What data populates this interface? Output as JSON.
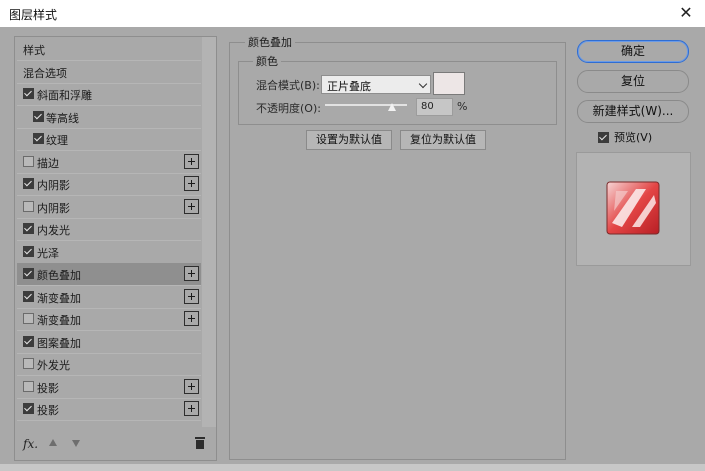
{
  "window": {
    "title": "图层样式",
    "close_glyph": "✕"
  },
  "styles_list": {
    "items": [
      {
        "label": "样式",
        "checkbox": false,
        "checked": false,
        "plus": false,
        "indent": false,
        "selected": false
      },
      {
        "label": "混合选项",
        "checkbox": false,
        "checked": false,
        "plus": false,
        "indent": false,
        "selected": false
      },
      {
        "label": "斜面和浮雕",
        "checkbox": true,
        "checked": true,
        "plus": false,
        "indent": false,
        "selected": false
      },
      {
        "label": "等高线",
        "checkbox": true,
        "checked": true,
        "plus": false,
        "indent": true,
        "selected": false
      },
      {
        "label": "纹理",
        "checkbox": true,
        "checked": true,
        "plus": false,
        "indent": true,
        "selected": false
      },
      {
        "label": "描边",
        "checkbox": true,
        "checked": false,
        "plus": true,
        "indent": false,
        "selected": false
      },
      {
        "label": "内阴影",
        "checkbox": true,
        "checked": true,
        "plus": true,
        "indent": false,
        "selected": false
      },
      {
        "label": "内阴影",
        "checkbox": true,
        "checked": false,
        "plus": true,
        "indent": false,
        "selected": false
      },
      {
        "label": "内发光",
        "checkbox": true,
        "checked": true,
        "plus": false,
        "indent": false,
        "selected": false
      },
      {
        "label": "光泽",
        "checkbox": true,
        "checked": true,
        "plus": false,
        "indent": false,
        "selected": false
      },
      {
        "label": "颜色叠加",
        "checkbox": true,
        "checked": true,
        "plus": true,
        "indent": false,
        "selected": true
      },
      {
        "label": "渐变叠加",
        "checkbox": true,
        "checked": true,
        "plus": true,
        "indent": false,
        "selected": false
      },
      {
        "label": "渐变叠加",
        "checkbox": true,
        "checked": false,
        "plus": true,
        "indent": false,
        "selected": false
      },
      {
        "label": "图案叠加",
        "checkbox": true,
        "checked": true,
        "plus": false,
        "indent": false,
        "selected": false
      },
      {
        "label": "外发光",
        "checkbox": true,
        "checked": false,
        "plus": false,
        "indent": false,
        "selected": false
      },
      {
        "label": "投影",
        "checkbox": true,
        "checked": false,
        "plus": true,
        "indent": false,
        "selected": false
      },
      {
        "label": "投影",
        "checkbox": true,
        "checked": true,
        "plus": true,
        "indent": false,
        "selected": false
      }
    ],
    "footer": {
      "fx_label": "fx."
    }
  },
  "color_overlay": {
    "group_title": "颜色叠加",
    "sub_title": "颜色",
    "blend_mode_label": "混合模式(B):",
    "blend_mode_value": "正片叠底",
    "overlay_color": "#ede6e6",
    "opacity_label": "不透明度(O):",
    "opacity_value": "80",
    "opacity_unit": "%",
    "set_default_button": "设置为默认值",
    "reset_default_button": "复位为默认值"
  },
  "actions": {
    "ok_button": "确定",
    "reset_button": "复位",
    "new_style_button": "新建样式(W)...",
    "preview_label": "预览(V)",
    "preview_checked": true
  }
}
